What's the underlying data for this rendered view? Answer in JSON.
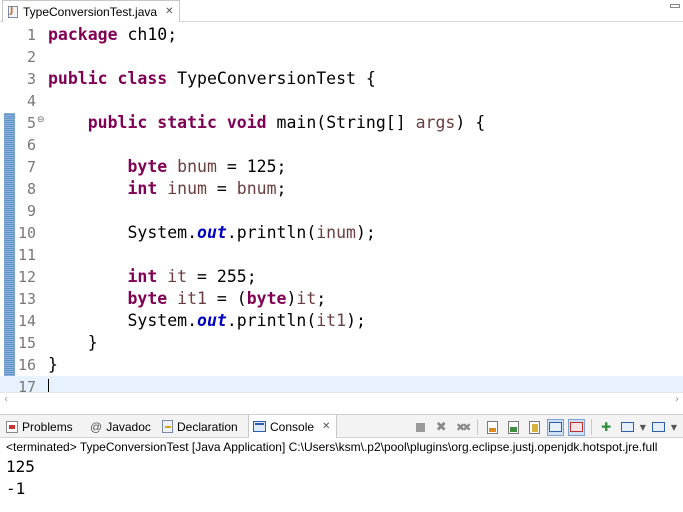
{
  "editor_tab": {
    "filename": "TypeConversionTest.java",
    "close": "✕"
  },
  "code": {
    "lines": [
      {
        "num": "1"
      },
      {
        "num": "2"
      },
      {
        "num": "3"
      },
      {
        "num": "4"
      },
      {
        "num": "5",
        "fold": "⊖"
      },
      {
        "num": "6"
      },
      {
        "num": "7"
      },
      {
        "num": "8"
      },
      {
        "num": "9"
      },
      {
        "num": "10"
      },
      {
        "num": "11"
      },
      {
        "num": "12"
      },
      {
        "num": "13"
      },
      {
        "num": "14"
      },
      {
        "num": "15"
      },
      {
        "num": "16"
      },
      {
        "num": "17"
      }
    ],
    "tokens": {
      "l1": {
        "kw": "package",
        "rest": " ch10;"
      },
      "l3": {
        "kw1": "public",
        "kw2": "class",
        "rest": " TypeConversionTest {"
      },
      "l5": {
        "indent": "    ",
        "kw1": "public",
        "kw2": "static",
        "kw3": "void",
        "mid": " main(String[] ",
        "var": "args",
        "rest": ") {"
      },
      "l7": {
        "indent": "        ",
        "kw": "byte",
        "sp": " ",
        "var": "bnum",
        "rest": " = 125;"
      },
      "l8": {
        "indent": "        ",
        "kw": "int",
        "sp": " ",
        "var": "inum",
        "mid": " = ",
        "var2": "bnum",
        "rest": ";"
      },
      "l10": {
        "indent": "        ",
        "pre": "System.",
        "fld": "out",
        "mid": ".println(",
        "var": "inum",
        "rest": ");"
      },
      "l12": {
        "indent": "        ",
        "kw": "int",
        "sp": " ",
        "var": "it",
        "rest": " = 255;"
      },
      "l13": {
        "indent": "        ",
        "kw": "byte",
        "sp": " ",
        "var": "it1",
        "mid": " = (",
        "kw2": "byte",
        "mid2": ")",
        "var2": "it",
        "rest": ";"
      },
      "l14": {
        "indent": "        ",
        "pre": "System.",
        "fld": "out",
        "mid": ".println(",
        "var": "it1",
        "rest": ");"
      },
      "l15": {
        "indent": "    ",
        "rest": "}"
      },
      "l16": {
        "rest": "}"
      }
    }
  },
  "scrollbar": {
    "left": "‹",
    "right": "›"
  },
  "views": {
    "tabs": [
      {
        "label": "Problems",
        "icon": "problems-icon"
      },
      {
        "label": "Javadoc",
        "icon": "at-icon",
        "glyph": "@"
      },
      {
        "label": "Declaration",
        "icon": "declaration-icon"
      },
      {
        "label": "Console",
        "icon": "console-icon",
        "close": "✕"
      }
    ],
    "toolbar_glyphs": {
      "remove": "✖",
      "remove_all": "✖✖",
      "pin": "✚",
      "dropdown": "▼"
    }
  },
  "console": {
    "header": "<terminated> TypeConversionTest [Java Application] C:\\Users\\ksm\\.p2\\pool\\plugins\\org.eclipse.justj.openjdk.hotspot.jre.full",
    "output": [
      "125",
      "-1"
    ]
  },
  "colors": {
    "keyword": "#7f0055",
    "variable": "#6a3e3e",
    "field": "#0000c0",
    "line_number": "#787878",
    "current_line": "#e8f2fe"
  }
}
